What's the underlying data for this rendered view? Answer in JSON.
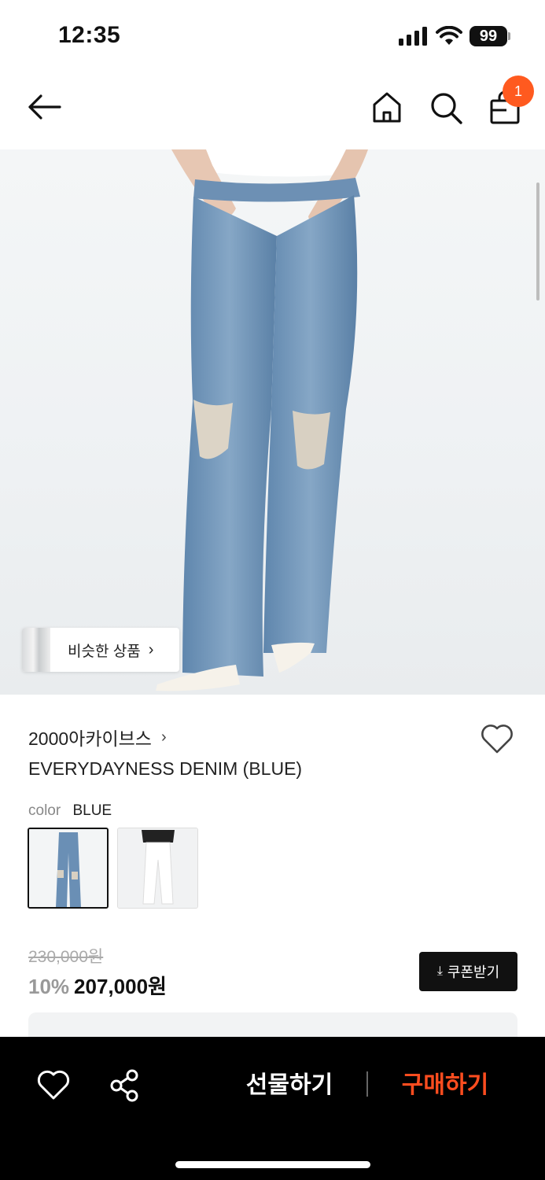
{
  "status_bar": {
    "time": "12:35",
    "battery": "99"
  },
  "header": {
    "cart_count": "1"
  },
  "product": {
    "similar_label": "비슷한 상품",
    "brand": "2000아카이브스",
    "name": "EVERYDAYNESS DENIM (BLUE)",
    "color_label": "color",
    "color_value": "BLUE",
    "swatches": [
      {
        "name": "BLUE",
        "selected": true
      },
      {
        "name": "WHITE",
        "selected": false
      }
    ],
    "original_price": "230,000원",
    "discount_rate": "10%",
    "final_price": "207,000원",
    "coupon_label": "쿠폰받기"
  },
  "bottom_bar": {
    "gift_label": "선물하기",
    "buy_label": "구매하기"
  },
  "colors": {
    "accent": "#ff5a1f",
    "buy": "#ff4d1f",
    "dark": "#111111"
  },
  "icons": [
    "back-arrow-icon",
    "home-icon",
    "search-icon",
    "shopping-bag-icon",
    "heart-icon",
    "share-icon",
    "download-icon",
    "chevron-right-icon"
  ]
}
